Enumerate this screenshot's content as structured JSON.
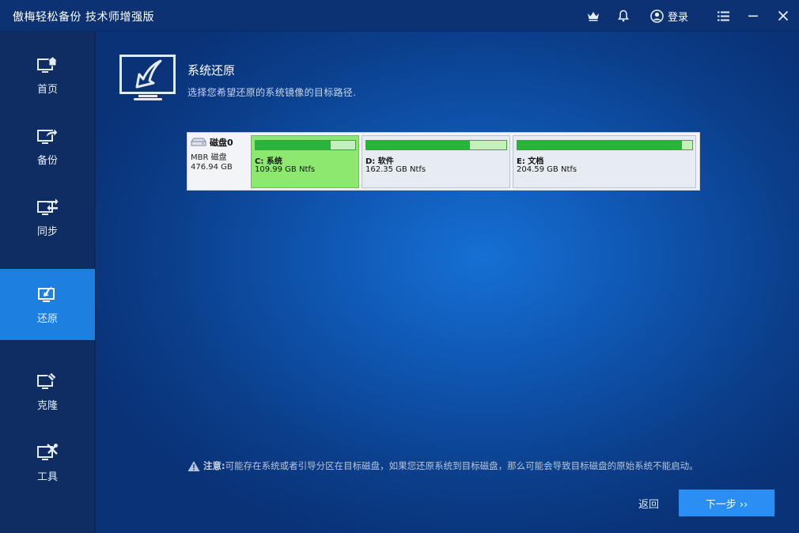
{
  "window": {
    "title": "傲梅轻松备份 技术师增强版"
  },
  "titlebar": {
    "login_label": "登录"
  },
  "sidebar": {
    "items": [
      {
        "label": "首页",
        "icon": "home-monitor-icon"
      },
      {
        "label": "备份",
        "icon": "backup-monitor-icon"
      },
      {
        "label": "同步",
        "icon": "sync-monitor-icon"
      },
      {
        "label": "还原",
        "icon": "restore-monitor-icon",
        "active": true
      },
      {
        "label": "克隆",
        "icon": "clone-monitor-icon"
      },
      {
        "label": "工具",
        "icon": "tools-monitor-icon"
      }
    ]
  },
  "main": {
    "title": "系统还原",
    "subtitle": "选择您希望还原的系统镜像的目标路径.",
    "disk": {
      "name": "磁盘0",
      "type": "MBR 磁盘",
      "size": "476.94 GB",
      "partitions": [
        {
          "name": "C: 系统",
          "info": "109.99 GB Ntfs",
          "used_fraction": 0.75,
          "selected": true
        },
        {
          "name": "D: 软件",
          "info": "162.35 GB Ntfs",
          "used_fraction": 0.74,
          "selected": false
        },
        {
          "name": "E: 文档",
          "info": "204.59 GB Ntfs",
          "used_fraction": 0.94,
          "selected": false
        }
      ]
    },
    "notice": {
      "label": "注意:",
      "text": "可能存在系统或者引导分区在目标磁盘，如果您还原系统到目标磁盘，那么可能会导致目标磁盘的原始系统不能启动。"
    },
    "back_label": "返回",
    "next_label": "下一步 ››"
  },
  "colors": {
    "titlebar": "#0d3273",
    "sidebar": "#0f2c63",
    "active_nav": "#1d7fe0",
    "selected_partition": "#8de870",
    "usage_bar": "#28b43c",
    "next_button": "#2a8ff2"
  }
}
